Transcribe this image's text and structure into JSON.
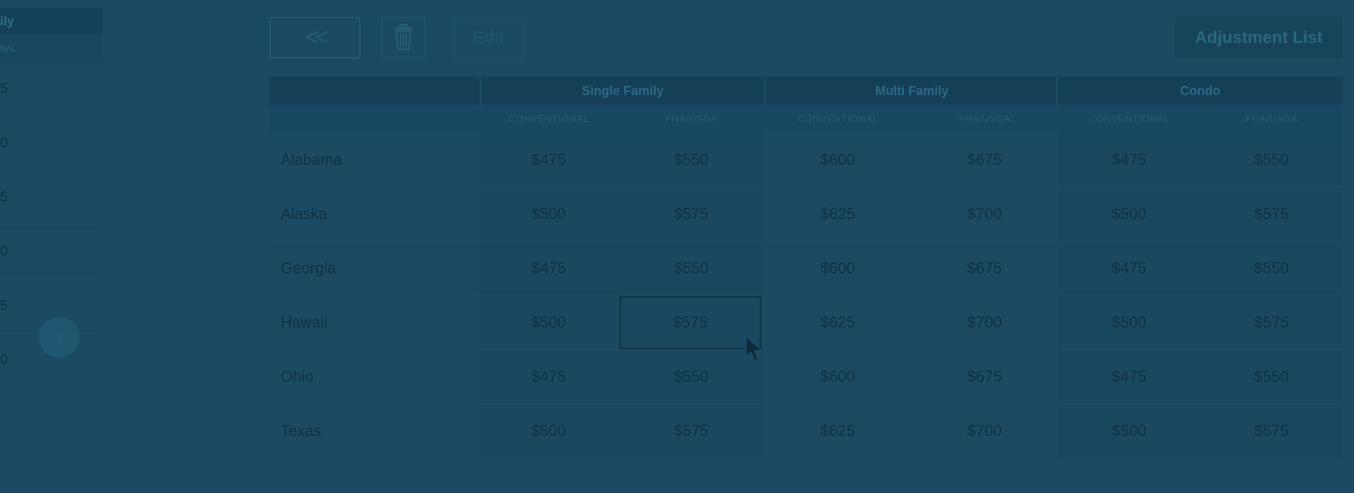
{
  "left_panel": {
    "header": "ily",
    "subheader": "NAL",
    "rows": [
      "5",
      "0",
      "5",
      "0",
      "5",
      "0"
    ],
    "next_icon": "chevron-right-icon"
  },
  "toolbar": {
    "back_label": "<<",
    "trash_icon": "trash-icon",
    "edit_label": "Edit",
    "adjustment_list_label": "Adjustment List"
  },
  "table": {
    "groups": [
      "Single Family",
      "Multi Family",
      "Condo"
    ],
    "subheaders": [
      "CONVENTIONAL",
      "FHA/USDA",
      "CONVENTIONAL",
      "FHA/USDA",
      "CONVENTIONAL",
      "FHA/USDA"
    ],
    "rows": [
      {
        "state": "Alabama",
        "values": [
          "$475",
          "$550",
          "$600",
          "$675",
          "$475",
          "$550"
        ]
      },
      {
        "state": "Alaska",
        "values": [
          "$500",
          "$575",
          "$625",
          "$700",
          "$500",
          "$575"
        ]
      },
      {
        "state": "Georgia",
        "values": [
          "$475",
          "$550",
          "$600",
          "$675",
          "$475",
          "$550"
        ]
      },
      {
        "state": "Hawaii",
        "values": [
          "$500",
          "$575",
          "$625",
          "$700",
          "$500",
          "$575"
        ]
      },
      {
        "state": "Ohio",
        "values": [
          "$475",
          "$550",
          "$600",
          "$675",
          "$475",
          "$550"
        ]
      },
      {
        "state": "Texas",
        "values": [
          "$500",
          "$575",
          "$625",
          "$700",
          "$500",
          "$575"
        ]
      }
    ]
  },
  "colors": {
    "overlay_background": "#1b4a62",
    "header_background": "#153f56"
  }
}
